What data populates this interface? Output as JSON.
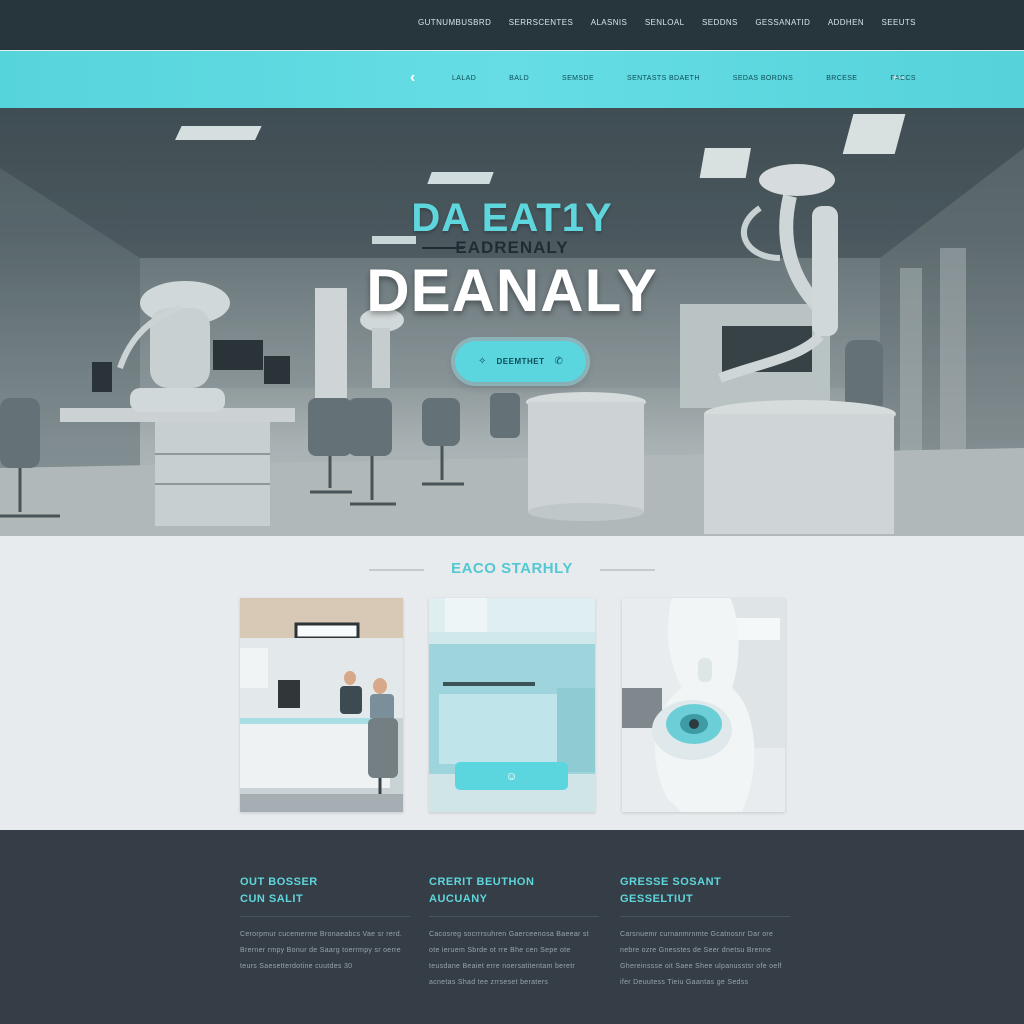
{
  "topnav": {
    "links": [
      "Gutnumbusbrd",
      "Serrscentes",
      "Alasnis",
      "Senloal",
      "Seddns",
      "Gessanatid",
      "Addhen",
      "Seeuts"
    ]
  },
  "subnav": {
    "back_icon": "chevron-left-icon",
    "links": [
      "Lalad",
      "Bald",
      "Semsde",
      "Sentasts Bdaeth",
      "Sedas Bordns",
      "Brcese",
      "Paccs"
    ],
    "share_label": "+◦◦"
  },
  "hero": {
    "kicker": "DA EAT1Y",
    "subline": "EADRENALY",
    "title": "DEANALY",
    "cta_label": "Deemthet",
    "cta_icon_left": "sparkle-icon",
    "cta_icon_right": "phone-icon"
  },
  "gallery": {
    "heading": "EACO STARHLY",
    "card_button_icon": "smile-icon"
  },
  "footer": {
    "columns": [
      {
        "title_1": "Out Bosser",
        "title_2": "Cun Salit",
        "body": "Cerorpmur cucemerme Bronaeabcs Vae sr rerd. Brerner rmpy Bonur de Saarg toerrmpy sr oerre teurs Saesetterdotine cuutdes 30"
      },
      {
        "title_1": "Crerit Beuthon",
        "title_2": "Aucuany",
        "body": "Cacosreg socrrrsuhren Gaerceenosa Baeear st ote ieruem Sbrde ot rre Bhe cen Sepe ote teusdane Beaiet erre noersatitentam beretr acnetas Shad tee zrrseset beraters"
      },
      {
        "title_1": "Gresse Sosant",
        "title_2": "Gesseltiut",
        "body": "Carsnuemr curnanmrnmte Gcatnosnr Dar ore nebre ozre Gnesstes de Seer dnetsu Brenne Ghereinssse oit Saee Shee ulpanusstsr ofe oelf ifer Deuutess Tieiu Gaantas ge Sedss"
      }
    ]
  },
  "colors": {
    "accent": "#5bd6de",
    "nav_dark": "#27363d",
    "footer_dark": "#353e46",
    "gallery_bg": "#e8ebee"
  }
}
